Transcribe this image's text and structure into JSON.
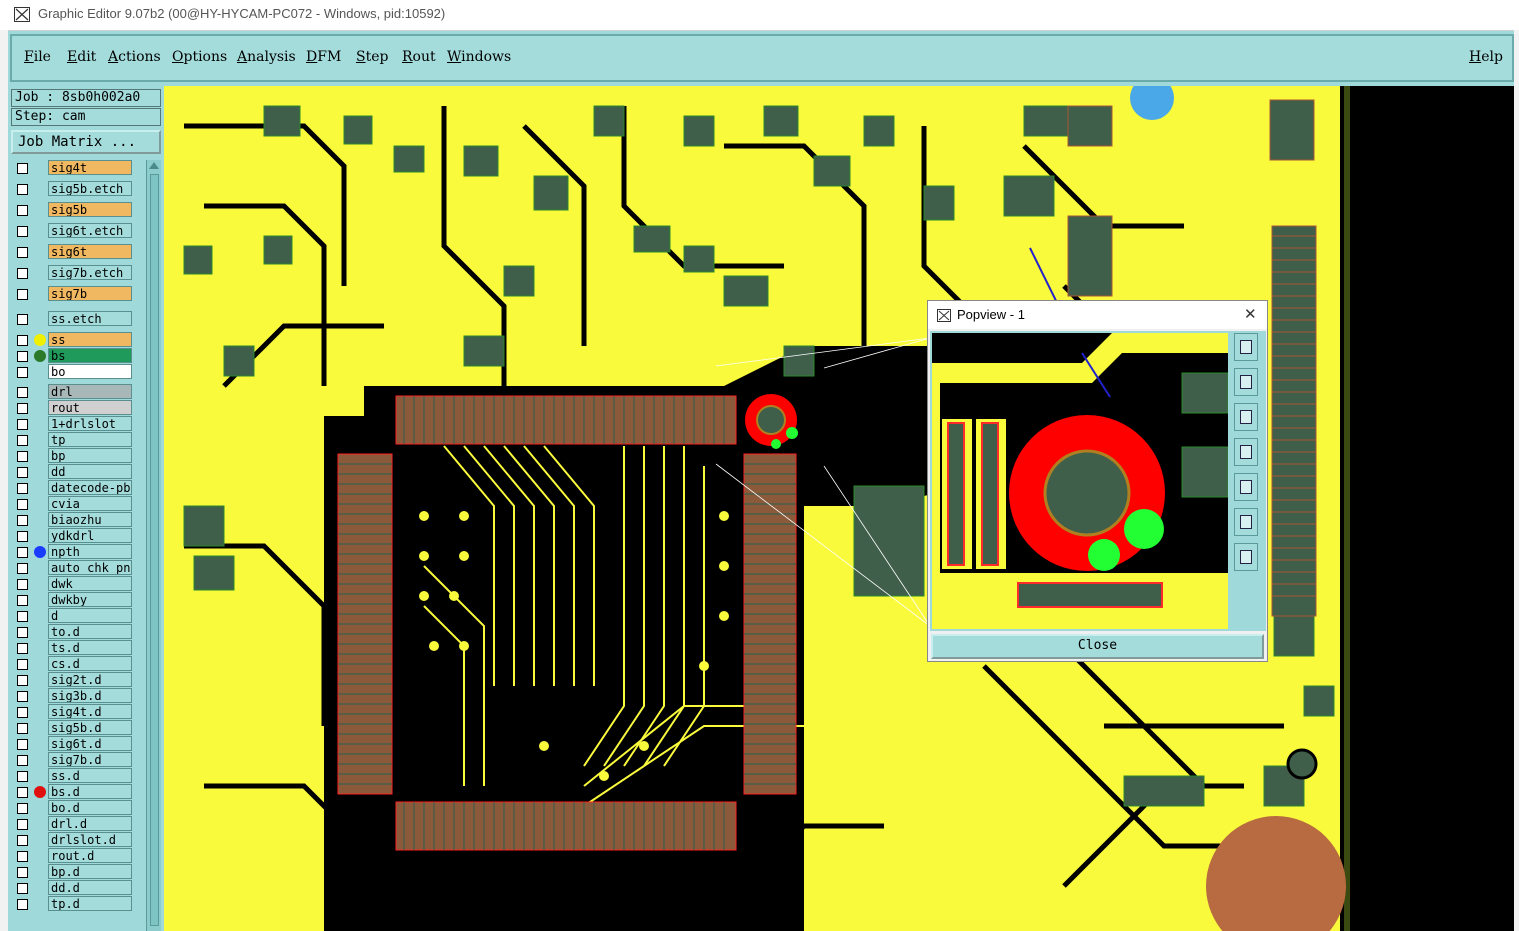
{
  "window": {
    "title": "Graphic Editor 9.07b2 (00@HY-HYCAM-PC072 - Windows, pid:10592)"
  },
  "menubar": {
    "items": [
      "File",
      "Edit",
      "Actions",
      "Options",
      "Analysis",
      "DFM",
      "Step",
      "Rout",
      "Windows"
    ],
    "help": "Help"
  },
  "left_panel": {
    "job": "Job : 8sb0h002a0",
    "step": "Step: cam",
    "job_matrix": "Job Matrix ...",
    "layers": [
      {
        "name": "sig4t",
        "bg": "#f0b860"
      },
      {
        "name": "sig5b.etch",
        "bg": "#a4dcdc"
      },
      {
        "name": "sig5b",
        "bg": "#f0b860"
      },
      {
        "name": "sig6t.etch",
        "bg": "#a4dcdc"
      },
      {
        "name": "sig6t",
        "bg": "#f0b860"
      },
      {
        "name": "sig7b.etch",
        "bg": "#a4dcdc"
      },
      {
        "name": "sig7b",
        "bg": "#f0b860"
      },
      {
        "name": "ss.etch",
        "bg": "#a4dcdc"
      },
      {
        "name": "ss",
        "bg": "#f0b860",
        "dot": "#f0f000"
      },
      {
        "name": "bs",
        "bg": "#1f9a5a",
        "dot": "#2a7a2a"
      },
      {
        "name": "bo",
        "bg": "#ffffff"
      },
      {
        "name": "drl",
        "bg": "#a8b8b8"
      },
      {
        "name": "rout",
        "bg": "#d0d0d0"
      },
      {
        "name": "1+drlslot",
        "bg": "#a4dcdc"
      },
      {
        "name": "tp",
        "bg": "#a4dcdc"
      },
      {
        "name": "bp",
        "bg": "#a4dcdc"
      },
      {
        "name": "dd",
        "bg": "#a4dcdc"
      },
      {
        "name": "datecode-pbe",
        "bg": "#a4dcdc"
      },
      {
        "name": "cvia",
        "bg": "#a4dcdc"
      },
      {
        "name": "biaozhu",
        "bg": "#a4dcdc"
      },
      {
        "name": "ydkdrl",
        "bg": "#a4dcdc"
      },
      {
        "name": "npth",
        "bg": "#a4dcdc",
        "dot": "#1a3cff"
      },
      {
        "name": "auto_chk_pnl",
        "bg": "#a4dcdc"
      },
      {
        "name": "dwk",
        "bg": "#a4dcdc"
      },
      {
        "name": "dwkby",
        "bg": "#a4dcdc"
      },
      {
        "name": "d",
        "bg": "#a4dcdc"
      },
      {
        "name": "to.d",
        "bg": "#a4dcdc"
      },
      {
        "name": "ts.d",
        "bg": "#a4dcdc"
      },
      {
        "name": "cs.d",
        "bg": "#a4dcdc"
      },
      {
        "name": "sig2t.d",
        "bg": "#a4dcdc"
      },
      {
        "name": "sig3b.d",
        "bg": "#a4dcdc"
      },
      {
        "name": "sig4t.d",
        "bg": "#a4dcdc"
      },
      {
        "name": "sig5b.d",
        "bg": "#a4dcdc"
      },
      {
        "name": "sig6t.d",
        "bg": "#a4dcdc"
      },
      {
        "name": "sig7b.d",
        "bg": "#a4dcdc"
      },
      {
        "name": "ss.d",
        "bg": "#a4dcdc"
      },
      {
        "name": "bs.d",
        "bg": "#a4dcdc",
        "dot": "#e01010"
      },
      {
        "name": "bo.d",
        "bg": "#a4dcdc"
      },
      {
        "name": "drl.d",
        "bg": "#a4dcdc"
      },
      {
        "name": "drlslot.d",
        "bg": "#a4dcdc"
      },
      {
        "name": "rout.d",
        "bg": "#a4dcdc"
      },
      {
        "name": "bp.d",
        "bg": "#a4dcdc"
      },
      {
        "name": "dd.d",
        "bg": "#a4dcdc"
      },
      {
        "name": "tp.d",
        "bg": "#a4dcdc"
      }
    ]
  },
  "popview": {
    "title": "Popview - 1",
    "close_label": "Close"
  },
  "colors": {
    "board_yellow": "#fafa3c",
    "pad_green": "#3f5f4a",
    "drill_red": "#ff0000",
    "highlight_green": "#22ff33"
  }
}
